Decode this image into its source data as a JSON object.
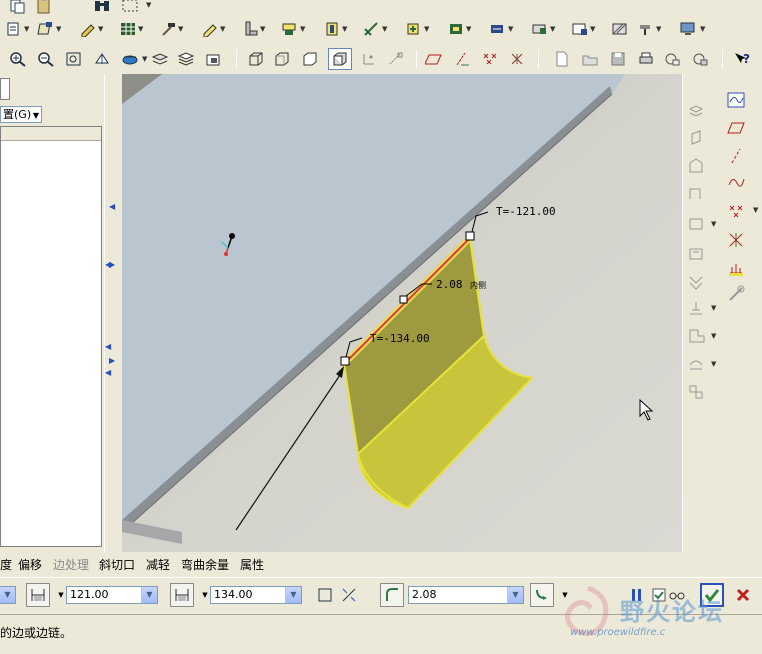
{
  "panel": {
    "select_label": "置(G)"
  },
  "viewport": {
    "dim_start": "T=-121.00",
    "dim_width": "2.08",
    "dim_width_suffix": "内侧",
    "dim_end": "T=-134.00"
  },
  "dashboard": {
    "tabs": [
      "度",
      "偏移",
      "边处理",
      "斜切口",
      "减轻",
      "弯曲余量",
      "属性"
    ],
    "offset1": "121.00",
    "offset2": "134.00",
    "thickness": "2.08"
  },
  "status": {
    "message": "的边或边链。"
  },
  "watermark": {
    "title": "野火论坛",
    "url": "www.proewildfire.c"
  },
  "colors": {
    "sheet_face": "#b8c6d0",
    "wall_fill": "#9e9a3f",
    "wall_edge": "#e6e23a",
    "highlight_edge": "#e03060",
    "background": "#d3d2cb"
  }
}
